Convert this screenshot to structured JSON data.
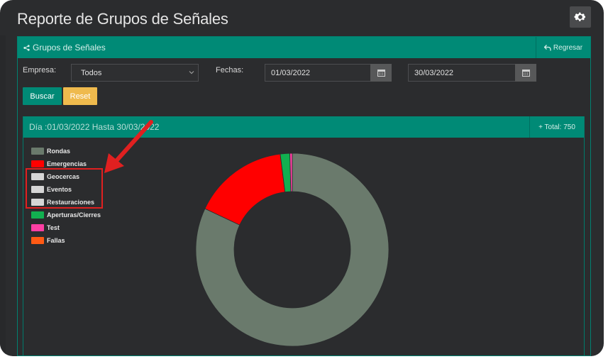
{
  "page": {
    "title": "Reporte de Grupos de Señales"
  },
  "panel": {
    "title": "Grupos de Señales",
    "back_label": "Regresar"
  },
  "filters": {
    "empresa_label": "Empresa:",
    "empresa_value": "Todos",
    "fechas_label": "Fechas:",
    "date_from": "01/03/2022",
    "date_to": "30/03/2022"
  },
  "buttons": {
    "search": "Buscar",
    "reset": "Reset"
  },
  "report": {
    "range": "Día :01/03/2022 Hasta 30/03/2022",
    "total": "+ Total: 750"
  },
  "colors": {
    "accent": "#008a76",
    "reset": "#efba4d",
    "annotation": "#e02020"
  },
  "icons": [
    "gear-icon",
    "share-icon",
    "undo-icon",
    "chevron-down-icon",
    "calendar-icon",
    "arrow-icon"
  ],
  "chart_data": {
    "type": "pie",
    "donut": true,
    "series": [
      {
        "name": "Rondas",
        "color": "#6a7a6c",
        "value": 615
      },
      {
        "name": "Emergencias",
        "color": "#ff0000",
        "value": 120
      },
      {
        "name": "Geocercas",
        "color": "#d6d6d6",
        "value": 0
      },
      {
        "name": "Eventos",
        "color": "#d6d6d6",
        "value": 0
      },
      {
        "name": "Restauraciones",
        "color": "#d6d6d6",
        "value": 0
      },
      {
        "name": "Aperturas/Cierres",
        "color": "#12b050",
        "value": 12
      },
      {
        "name": "Test",
        "color": "#ff3fa4",
        "value": 3
      },
      {
        "name": "Fallas",
        "color": "#ff5a14",
        "value": 0
      }
    ]
  }
}
